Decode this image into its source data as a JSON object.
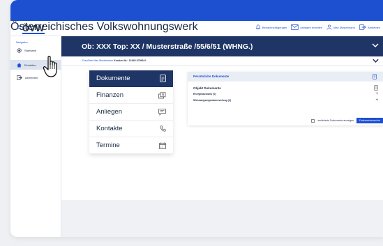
{
  "header": {
    "logo_text": "ÖVW",
    "logo_sub": "Österreichisches Volkswohnungswerk",
    "nav": [
      {
        "label": "Benachrichtigungen",
        "icon": "bell-icon"
      },
      {
        "label": "Anliegen erstellen",
        "icon": "mail-icon"
      },
      {
        "label": "Max Mustermann",
        "icon": "user-icon"
      },
      {
        "label": "Abmelden",
        "icon": "logout-icon"
      }
    ]
  },
  "sidebar": {
    "title": "Navigation",
    "items": [
      {
        "label": "Startseite",
        "icon": "target-icon",
        "active": false
      },
      {
        "label": "Einheiten",
        "icon": "home-icon",
        "active": true
      },
      {
        "label": "Abmelden",
        "icon": "logout-icon",
        "active": false
      }
    ]
  },
  "object": {
    "title": "Ob: XXX Top: XX / Musterstraße /55/6/51 (WHNG.)"
  },
  "customer": {
    "name": "Frau/Herr Max Mustermann",
    "number_label": "Kunden Nr.: 12345-67890-X"
  },
  "menu": [
    {
      "label": "Dokumente",
      "icon": "document-icon",
      "active": true
    },
    {
      "label": "Finanzen",
      "icon": "money-icon",
      "active": false
    },
    {
      "label": "Anliegen",
      "icon": "chat-icon",
      "active": false
    },
    {
      "label": "Kontakte",
      "icon": "phone-icon",
      "active": false
    },
    {
      "label": "Termine",
      "icon": "calendar-icon",
      "active": false
    }
  ],
  "documents": {
    "title": "Persönliche Dokumente",
    "section": "Objekt Dokumente",
    "rows": [
      {
        "label": "Energieausweis (0)"
      },
      {
        "label": "Wohnungseigentumsvertrag (2)"
      }
    ],
    "archived_label": "archivierte Dokumente anzeigen",
    "search_button": "Dokumentensuche"
  },
  "colors": {
    "brand_blue": "#1d4fd1",
    "navy": "#1f3566"
  }
}
